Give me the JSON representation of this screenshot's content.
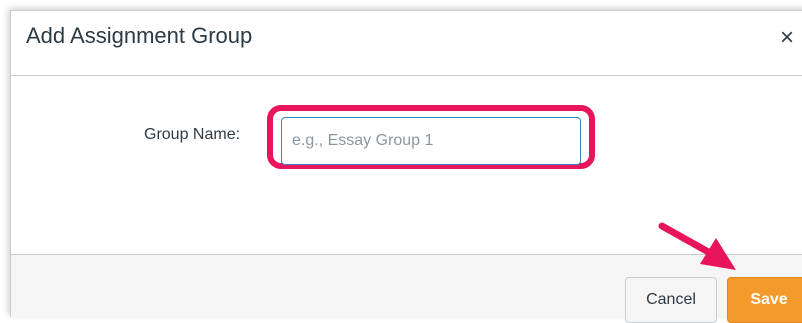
{
  "dialog": {
    "title": "Add Assignment Group",
    "close_symbol": "×"
  },
  "form": {
    "group_name_label": "Group Name:",
    "group_name_value": "",
    "group_name_placeholder": "e.g., Essay Group 1"
  },
  "footer": {
    "cancel_label": "Cancel",
    "save_label": "Save"
  },
  "icons": {
    "close": "close-icon",
    "annotation_arrow": "arrow-icon"
  },
  "colors": {
    "highlight": "#e8155d",
    "save_button": "#f49a2c",
    "input_focus_border": "#3b7fc4",
    "annotation_arrow": "#e8155d"
  }
}
